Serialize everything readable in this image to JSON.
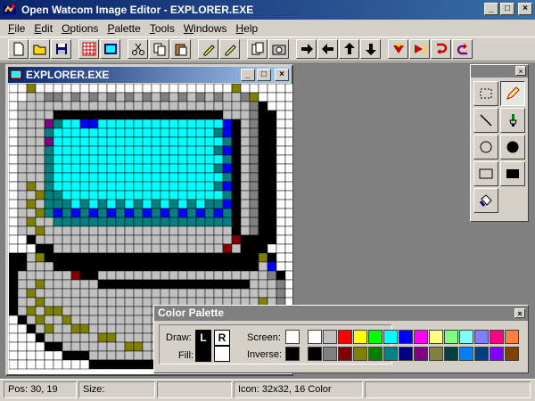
{
  "window": {
    "title": "Open Watcom Image Editor - EXPLORER.EXE",
    "app_icon": "watcom-icon"
  },
  "title_buttons": {
    "minimize": "_",
    "maximize": "□",
    "close": "×"
  },
  "menu": [
    {
      "label": "File",
      "underline": "F",
      "rest": "ile"
    },
    {
      "label": "Edit",
      "underline": "E",
      "rest": "dit"
    },
    {
      "label": "Options",
      "underline": "O",
      "rest": "ptions"
    },
    {
      "label": "Palette",
      "underline": "P",
      "rest": "alette"
    },
    {
      "label": "Tools",
      "underline": "T",
      "rest": "ools"
    },
    {
      "label": "Windows",
      "underline": "W",
      "rest": "indows"
    },
    {
      "label": "Help",
      "underline": "H",
      "rest": "elp"
    }
  ],
  "toolbar": [
    {
      "icon": "new-file-icon"
    },
    {
      "icon": "open-folder-icon"
    },
    {
      "icon": "save-disk-icon"
    },
    {
      "gap": true
    },
    {
      "icon": "grid-toggle-icon"
    },
    {
      "icon": "view-icon-icon"
    },
    {
      "gap": true
    },
    {
      "icon": "cut-icon"
    },
    {
      "icon": "copy-icon"
    },
    {
      "icon": "paste-icon"
    },
    {
      "gap": true
    },
    {
      "icon": "undo-pencil-icon"
    },
    {
      "icon": "redo-pencil-icon"
    },
    {
      "gap": true
    },
    {
      "icon": "clipboard-icon"
    },
    {
      "icon": "snapshot-camera-icon"
    },
    {
      "gap": true
    },
    {
      "icon": "shift-right-icon"
    },
    {
      "icon": "shift-left-icon"
    },
    {
      "icon": "shift-up-icon"
    },
    {
      "icon": "shift-down-icon"
    },
    {
      "gap": true
    },
    {
      "icon": "flip-horizontal-icon"
    },
    {
      "icon": "flip-vertical-icon"
    },
    {
      "icon": "rotate-clockwise-icon"
    },
    {
      "icon": "rotate-counterclockwise-icon"
    }
  ],
  "child_window": {
    "title": "EXPLORER.EXE"
  },
  "tools": [
    {
      "icon": "select-rectangle-icon",
      "active": false
    },
    {
      "icon": "pencil-icon",
      "active": true
    },
    {
      "icon": "line-icon",
      "active": false
    },
    {
      "icon": "brush-icon",
      "active": false
    },
    {
      "icon": "circle-outline-icon",
      "active": false
    },
    {
      "icon": "circle-filled-icon",
      "active": false
    },
    {
      "icon": "rectangle-outline-icon",
      "active": false
    },
    {
      "icon": "rectangle-filled-icon",
      "active": false
    },
    {
      "icon": "fill-bucket-icon",
      "active": false
    }
  ],
  "color_palette": {
    "title": "Color Palette",
    "draw_label": "Draw:",
    "fill_label": "Fill:",
    "left_label": "L",
    "right_label": "R",
    "screen_label": "Screen:",
    "inverse_label": "Inverse:",
    "screen_color": "#ffffff",
    "inverse_color": "#000000",
    "row1": [
      "#ffffff",
      "#c0c0c0",
      "#ff0000",
      "#ffff00",
      "#00ff00",
      "#00ffff",
      "#0000ff",
      "#ff00ff",
      "#ffff80",
      "#80ff80",
      "#80ffff",
      "#8080ff",
      "#ff0080",
      "#ff8040"
    ],
    "row2": [
      "#000000",
      "#808080",
      "#800000",
      "#808000",
      "#008000",
      "#008080",
      "#000080",
      "#800080",
      "#808040",
      "#004040",
      "#0080ff",
      "#004080",
      "#8000ff",
      "#804000"
    ]
  },
  "status": {
    "position": "Pos: 30, 19",
    "size": "Size:",
    "icon_info": "Icon: 32x32, 16 Color"
  },
  "icon_palette": {
    "W": "#ffffff",
    "L": "#c0c0c0",
    "G": "#808080",
    "K": "#000000",
    "Y": "#808000",
    "T": "#008080",
    "C": "#00ffff",
    "B": "#0000ff",
    "P": "#800080",
    "R": "#800000",
    "N": "#000080",
    "M": "#ff00ff",
    "D": "#404040",
    "S": "#a0a0a0",
    "X": "#e0e0e0"
  },
  "icon_pixels": [
    "WWYWWWWWWWWWWWWWWWWWWWWWWYWWWWWW",
    "WWLLGGLGLGLGLGLGLGLGLGLGLLGYWWWW",
    "WLLLLLLLLLLLLLLLLLLLLLLLLLLGKWWW",
    "WLLLLKKKKKKKKKKKKKKKKKKKLLLGKKWW",
    "WLLLPTCCBBCCCCCCCCCCCCCCBKLGKKWW",
    "WLLLTCCCCCCCCCCCCCCCCCCTBKLGKKWW",
    "WLLLPCCCCCCCCCCCCCCCCCCCTKLGKKWW",
    "WLLLTCCCCCCCCCCCCCCCCCCTBKLGKKWW",
    "WLLLTCCCCCCCCCCCCCCCCCCCTKLGKKWW",
    "WLLLTCCCCCCCCCCCCCCCCCCTBKLGKKWW",
    "WLLLTCCCCCCCCCCCCCCCCCCCTKLGKKWW",
    "WLYLTCCCCCCCCCCCCCCCCCCTBKLGKKWW",
    "WLLYTTCCCCCCCCCCCCCCCCCCTKLGKKWW",
    "WLYLTTTCTCTCTCTCTCTCTCTTBKLGKKWW",
    "WLLYTBTBTBTBTBTBTBTBTBTBTKLGKKWW",
    "WLYLLTTTTTTTTTTTTTTTTTTTTKLGKKWW",
    "WLLYLLLLLLLLLLLLLLLLLLLLLKLGKKWW",
    "WWKLLLLLLLLLLLLLLLLLLLLLLRKKKKWW",
    "WWWKKLLLLLLLLLLLLLLLLLLLRLKKKWWW",
    "KKLYKKKKKKKKKKKKKKKKKKKKKKKKYKWW",
    "KKLLLKKKKKKKKKKKKKKKKKKKKKKKLBWW",
    "KLLLLLLRKKLLLLLLLLLLLLLLLLLLLGKW",
    "KLLYLLLLLLKKKKKKKKKKKKKKKKKLLLGW",
    "KLYLLLLLLLLLLLLLLLLLLLLLLLLLLLGW",
    "KLLYLLLLLLLLLLLLLLLLLLLLLLLLYLGW",
    "KLYLYYLLLLLLLLLLLLLLLLLLLLLLLLKW",
    "WKLYLLYLLLLLLLLLLLLLLLLLLLLLLKWW",
    "WWKLYLLYYLLLLLLLLLLLLLLLLLLLKWWW",
    "WWWKLLLLLLYYLLLLLLLLLLLLLLKKWWWW",
    "WWWWKKLLLLLLLYYLLLLLLLLLKKWWWWWW",
    "WWWWWWKKKLLLLLLLLLLLLKKKWWWWWWWW",
    "WWWWWWWWWKKKKKKKKKKKKWWWWWWWWWWW"
  ]
}
